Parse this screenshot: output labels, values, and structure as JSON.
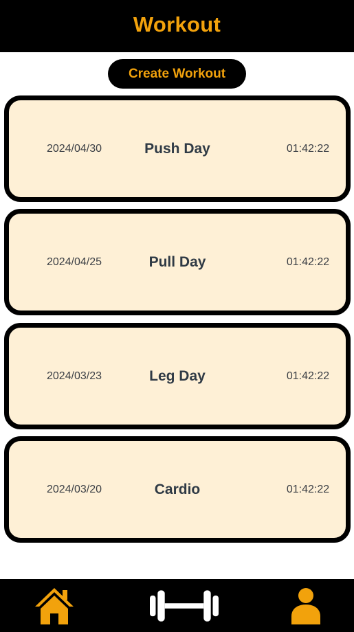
{
  "header": {
    "title": "Workout"
  },
  "actions": {
    "create_label": "Create Workout"
  },
  "workouts": [
    {
      "date": "2024/04/30",
      "name": "Push Day",
      "duration": "01:42:22"
    },
    {
      "date": "2024/04/25",
      "name": "Pull Day",
      "duration": "01:42:22"
    },
    {
      "date": "2024/03/23",
      "name": "Leg Day",
      "duration": "01:42:22"
    },
    {
      "date": "2024/03/20",
      "name": "Cardio",
      "duration": "01:42:22"
    }
  ],
  "nav": {
    "items": [
      {
        "icon": "home-icon"
      },
      {
        "icon": "dumbbell-icon"
      },
      {
        "icon": "user-icon"
      }
    ]
  },
  "colors": {
    "accent": "#f2a20c",
    "bar": "#000000",
    "card_background": "#fef0d6",
    "text": "#2f3a45"
  }
}
